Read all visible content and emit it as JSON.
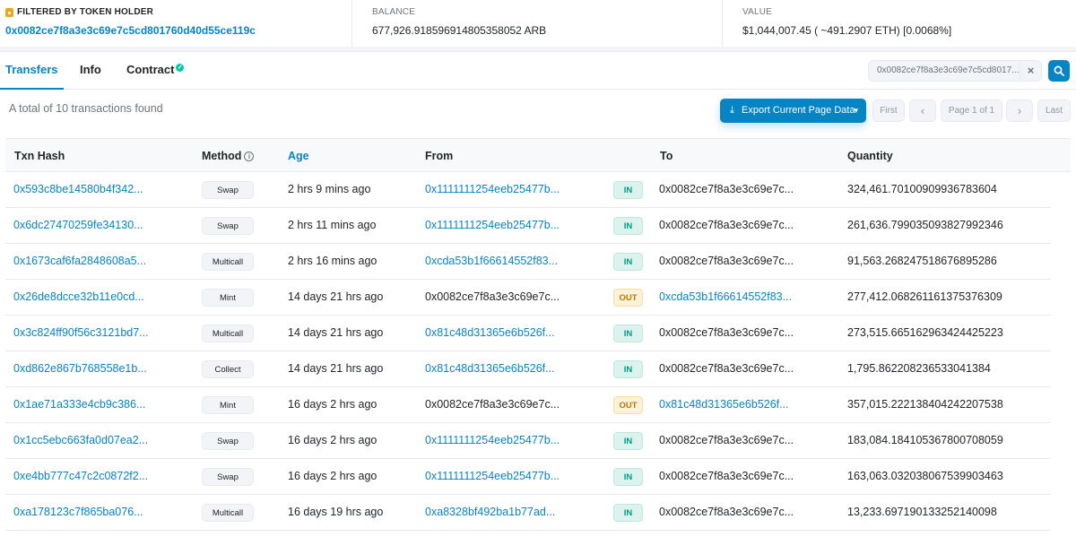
{
  "header": {
    "filter": {
      "label": "FILTERED BY TOKEN HOLDER",
      "value": "0x0082ce7f8a3e3c69e7c5cd801760d40d55ce119c"
    },
    "balance": {
      "label": "BALANCE",
      "value": "677,926.918596914805358052 ARB"
    },
    "value": {
      "label": "VALUE",
      "value": "$1,044,007.45 ( ~491.2907 ETH) [0.0068%]"
    }
  },
  "tabs": [
    {
      "label": "Transfers",
      "active": true
    },
    {
      "label": "Info",
      "active": false
    },
    {
      "label": "Contract",
      "active": false,
      "verified": true
    }
  ],
  "search": {
    "value": "0x0082ce7f8a3e3c69e7c5cd8017...",
    "clear_icon": "close-icon",
    "search_icon": "search-icon"
  },
  "summary": "A total of 10 transactions found",
  "toolbar": {
    "export_label": "Export Current Page Data"
  },
  "pagination": {
    "first": "First",
    "prev": "‹",
    "page_info": "Page 1 of 1",
    "next": "›",
    "last": "Last"
  },
  "columns": {
    "txn_hash": "Txn Hash",
    "method": "Method",
    "age": "Age",
    "from": "From",
    "to": "To",
    "quantity": "Quantity"
  },
  "colors": {
    "accent": "#0784c3",
    "in": "#00a186",
    "out": "#b47d00"
  },
  "rows": [
    {
      "hash": "0x593c8be14580b4f342...",
      "method": "Swap",
      "age": "2 hrs 9 mins ago",
      "from": "0x1111111254eeb25477b...",
      "dir": "IN",
      "to": "0x0082ce7f8a3e3c69e7c...",
      "quantity": "324,461.70100909936783604"
    },
    {
      "hash": "0x6dc27470259fe34130...",
      "method": "Swap",
      "age": "2 hrs 11 mins ago",
      "from": "0x1111111254eeb25477b...",
      "dir": "IN",
      "to": "0x0082ce7f8a3e3c69e7c...",
      "quantity": "261,636.799035093827992346"
    },
    {
      "hash": "0x1673caf6fa2848608a5...",
      "method": "Multicall",
      "age": "2 hrs 16 mins ago",
      "from": "0xcda53b1f66614552f83...",
      "dir": "IN",
      "to": "0x0082ce7f8a3e3c69e7c...",
      "quantity": "91,563.268247518676895286"
    },
    {
      "hash": "0x26de8dcce32b11e0cd...",
      "method": "Mint",
      "age": "14 days 21 hrs ago",
      "from": "0x0082ce7f8a3e3c69e7c...",
      "dir": "OUT",
      "to": "0xcda53b1f66614552f83...",
      "quantity": "277,412.068261161375376309"
    },
    {
      "hash": "0x3c824ff90f56c3121bd7...",
      "method": "Multicall",
      "age": "14 days 21 hrs ago",
      "from": "0x81c48d31365e6b526f...",
      "dir": "IN",
      "to": "0x0082ce7f8a3e3c69e7c...",
      "quantity": "273,515.665162963424425223"
    },
    {
      "hash": "0xd862e867b768558e1b...",
      "method": "Collect",
      "age": "14 days 21 hrs ago",
      "from": "0x81c48d31365e6b526f...",
      "dir": "IN",
      "to": "0x0082ce7f8a3e3c69e7c...",
      "quantity": "1,795.862208236533041384"
    },
    {
      "hash": "0x1ae71a333e4cb9c386...",
      "method": "Mint",
      "age": "16 days 2 hrs ago",
      "from": "0x0082ce7f8a3e3c69e7c...",
      "dir": "OUT",
      "to": "0x81c48d31365e6b526f...",
      "quantity": "357,015.222138404242207538"
    },
    {
      "hash": "0x1cc5ebc663fa0d07ea2...",
      "method": "Swap",
      "age": "16 days 2 hrs ago",
      "from": "0x1111111254eeb25477b...",
      "dir": "IN",
      "to": "0x0082ce7f8a3e3c69e7c...",
      "quantity": "183,084.184105367800708059"
    },
    {
      "hash": "0xe4bb777c47c2c0872f2...",
      "method": "Swap",
      "age": "16 days 2 hrs ago",
      "from": "0x1111111254eeb25477b...",
      "dir": "IN",
      "to": "0x0082ce7f8a3e3c69e7c...",
      "quantity": "163,063.032038067539903463"
    },
    {
      "hash": "0xa178123c7f865ba076...",
      "method": "Multicall",
      "age": "16 days 19 hrs ago",
      "from": "0xa8328bf492ba1b77ad...",
      "dir": "IN",
      "to": "0x0082ce7f8a3e3c69e7c...",
      "quantity": "13,233.697190133252140098"
    }
  ]
}
